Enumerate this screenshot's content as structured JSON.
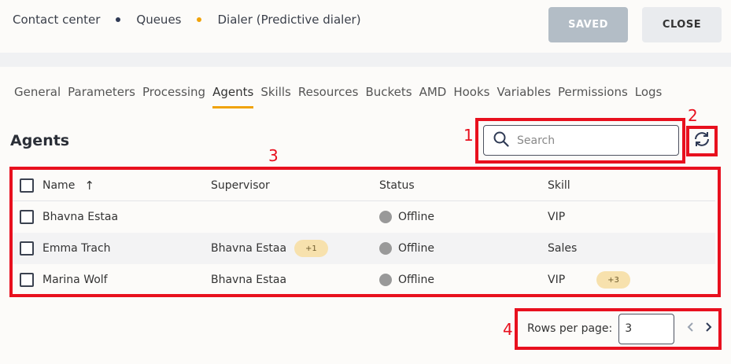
{
  "breadcrumb": {
    "items": [
      "Contact center",
      "Queues",
      "Dialer (Predictive dialer)"
    ],
    "dot_colors": [
      "#2f3a55",
      "#f0a30a"
    ]
  },
  "header": {
    "saved_label": "SAVED",
    "close_label": "CLOSE"
  },
  "tabs": [
    {
      "label": "General"
    },
    {
      "label": "Parameters"
    },
    {
      "label": "Processing"
    },
    {
      "label": "Agents",
      "active": true
    },
    {
      "label": "Skills"
    },
    {
      "label": "Resources"
    },
    {
      "label": "Buckets"
    },
    {
      "label": "AMD"
    },
    {
      "label": "Hooks"
    },
    {
      "label": "Variables"
    },
    {
      "label": "Permissions"
    },
    {
      "label": "Logs"
    }
  ],
  "section": {
    "title": "Agents"
  },
  "search": {
    "placeholder": "Search",
    "value": ""
  },
  "table": {
    "columns": {
      "name": "Name",
      "sort_arrow": "↑",
      "supervisor": "Supervisor",
      "status": "Status",
      "skill": "Skill"
    },
    "rows": [
      {
        "name": "Bhavna Estaa",
        "supervisor": "",
        "supervisor_extra": "",
        "status": "Offline",
        "skill": "VIP",
        "skill_extra": ""
      },
      {
        "name": "Emma Trach",
        "supervisor": "Bhavna Estaa",
        "supervisor_extra": "+1",
        "status": "Offline",
        "skill": "Sales",
        "skill_extra": ""
      },
      {
        "name": "Marina Wolf",
        "supervisor": "Bhavna Estaa",
        "supervisor_extra": "",
        "status": "Offline",
        "skill": "VIP",
        "skill_extra": "+3"
      }
    ]
  },
  "pagination": {
    "rows_per_page_label": "Rows per page:",
    "rows_per_page_value": "3"
  },
  "annotations": {
    "one": "1",
    "two": "2",
    "three": "3",
    "four": "4"
  },
  "colors": {
    "accent": "#f0a30a",
    "annotation": "#e8101e",
    "chip": "#f7e1ad",
    "offline": "#999999"
  }
}
